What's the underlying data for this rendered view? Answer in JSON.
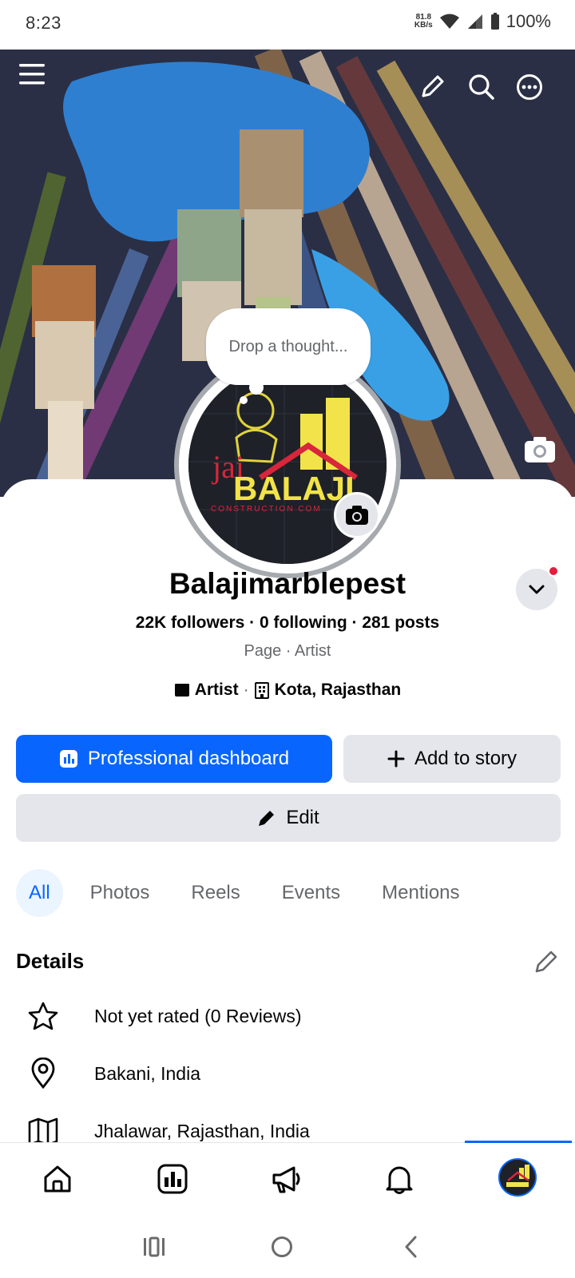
{
  "status_bar": {
    "time": "8:23",
    "net_speed_value": "81.8",
    "net_speed_unit": "KB/s",
    "battery": "100%"
  },
  "cover": {
    "thought_bubble_placeholder": "Drop a thought..."
  },
  "avatar_logo": {
    "line1": "jai",
    "line2": "BALAJI",
    "line3": "CONSTRUCTION COM"
  },
  "profile": {
    "name": "Balajimarblepest",
    "stats": "22K followers · 0 following · 281 posts",
    "page_category": "Page · Artist",
    "tag_category": "Artist",
    "tag_separator": "·",
    "tag_location": "Kota, Rajasthan"
  },
  "actions": {
    "professional_dashboard": "Professional dashboard",
    "add_to_story": "Add to story",
    "edit": "Edit"
  },
  "tabs": [
    "All",
    "Photos",
    "Reels",
    "Events",
    "Mentions"
  ],
  "details": {
    "title": "Details",
    "items": [
      {
        "icon": "star-icon",
        "text": "Not yet rated (0 Reviews)"
      },
      {
        "icon": "location-pin-icon",
        "text": "Bakani, India"
      },
      {
        "icon": "map-icon",
        "text": "Jhalawar, Rajasthan, India"
      }
    ]
  },
  "bottom_nav": [
    "home-icon",
    "dashboard-icon",
    "megaphone-icon",
    "bell-icon",
    "profile-avatar"
  ],
  "colors": {
    "accent": "#0866ff",
    "secondary_button": "#e4e6eb",
    "text_secondary": "#65676b",
    "notification_dot": "#e41e3f"
  }
}
